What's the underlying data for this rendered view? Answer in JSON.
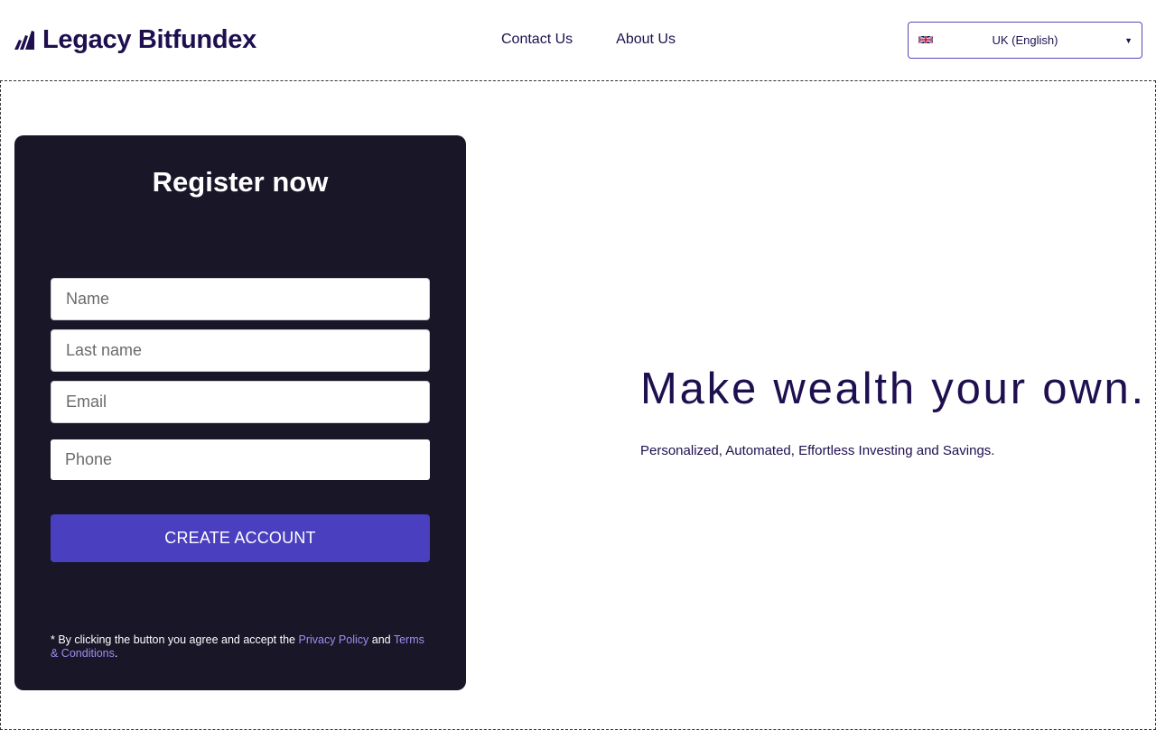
{
  "header": {
    "brand": "Legacy Bitfundex",
    "nav": [
      {
        "label": "Contact Us"
      },
      {
        "label": "About Us"
      }
    ],
    "language": {
      "selected": "UK (English)",
      "flag_icon": "uk-flag-icon"
    }
  },
  "register": {
    "title": "Register now",
    "fields": {
      "name_placeholder": "Name",
      "last_name_placeholder": "Last name",
      "email_placeholder": "Email",
      "phone_placeholder": "Phone"
    },
    "submit_label": "CREATE ACCOUNT",
    "terms": {
      "prefix": "* By clicking the button you agree and accept the ",
      "privacy_link": "Privacy Policy",
      "and": " and ",
      "terms_link": "Terms & Conditions",
      "suffix": "."
    }
  },
  "hero": {
    "headline": "Make wealth your own.",
    "subheadline": "Personalized, Automated, Effortless Investing and Savings."
  },
  "colors": {
    "brand_dark": "#1e0f4f",
    "card_background": "#191628",
    "button_accent": "#4a3fbf",
    "link_accent": "#9b90f0"
  }
}
